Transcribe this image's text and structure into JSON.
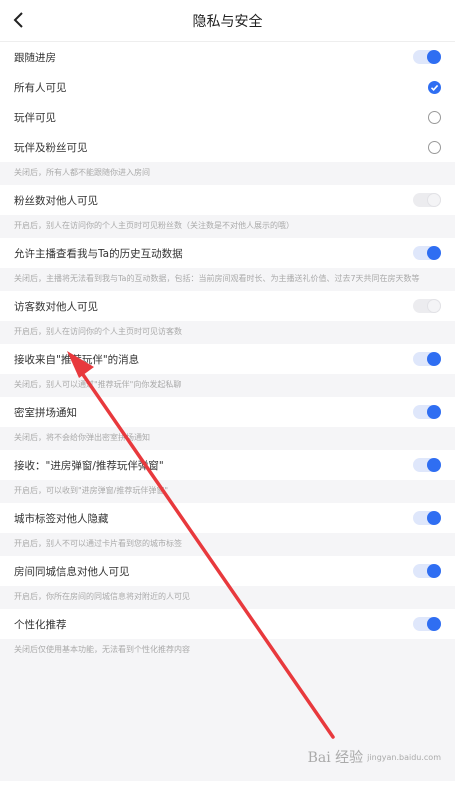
{
  "header": {
    "title": "隐私与安全"
  },
  "sections": [
    {
      "rows": [
        {
          "label": "跟随进房",
          "control": "toggle",
          "on": true
        },
        {
          "label": "所有人可见",
          "control": "radio",
          "checked": true
        },
        {
          "label": "玩伴可见",
          "control": "radio",
          "checked": false
        },
        {
          "label": "玩伴及粉丝可见",
          "control": "radio",
          "checked": false
        }
      ],
      "hint": "关闭后，所有人都不能跟随你进入房间"
    },
    {
      "rows": [
        {
          "label": "粉丝数对他人可见",
          "control": "toggle",
          "on": false
        }
      ],
      "hint": "开启后，别人在访问你的个人主页时可见粉丝数（关注数是不对他人展示的哦）"
    },
    {
      "rows": [
        {
          "label": "允许主播查看我与Ta的历史互动数据",
          "control": "toggle",
          "on": true
        }
      ],
      "hint": "关闭后，主播将无法看到我与Ta的互动数据，包括：当前房间观看时长、为主播送礼价值、过去7天共同在房天数等"
    },
    {
      "rows": [
        {
          "label": "访客数对他人可见",
          "control": "toggle",
          "on": false
        }
      ],
      "hint": "开启后，别人在访问你的个人主页时可见访客数"
    },
    {
      "rows": [
        {
          "label": "接收来自\"推荐玩伴\"的消息",
          "control": "toggle",
          "on": true
        }
      ],
      "hint": "关闭后，别人可以通过\"推荐玩伴\"向你发起私聊"
    },
    {
      "rows": [
        {
          "label": "密室拼场通知",
          "control": "toggle",
          "on": true
        }
      ],
      "hint": "关闭后，将不会给你弹出密室拼场通知"
    },
    {
      "rows": [
        {
          "label": "接收：\"进房弹窗/推荐玩伴弹窗\"",
          "control": "toggle",
          "on": true
        }
      ],
      "hint": "开启后，可以收到\"进房弹窗/推荐玩伴弹窗\""
    },
    {
      "rows": [
        {
          "label": "城市标签对他人隐藏",
          "control": "toggle",
          "on": true
        }
      ],
      "hint": "开启后，别人不可以通过卡片看到您的城市标签"
    },
    {
      "rows": [
        {
          "label": "房间同城信息对他人可见",
          "control": "toggle",
          "on": true
        }
      ],
      "hint": "开启后，你所在房间的同城信息将对附近的人可见"
    },
    {
      "rows": [
        {
          "label": "个性化推荐",
          "control": "toggle",
          "on": true
        }
      ],
      "hint": "关闭后仅使用基本功能，无法看到个性化推荐内容"
    }
  ],
  "watermark": {
    "logo": "Bai 经验",
    "sub": "jingyan.baidu.com"
  },
  "colors": {
    "accent": "#2f6ef2",
    "annotation_arrow": "#e8393d"
  },
  "icons": {
    "back": "chevron-left-icon",
    "check": "checkmark-icon"
  }
}
